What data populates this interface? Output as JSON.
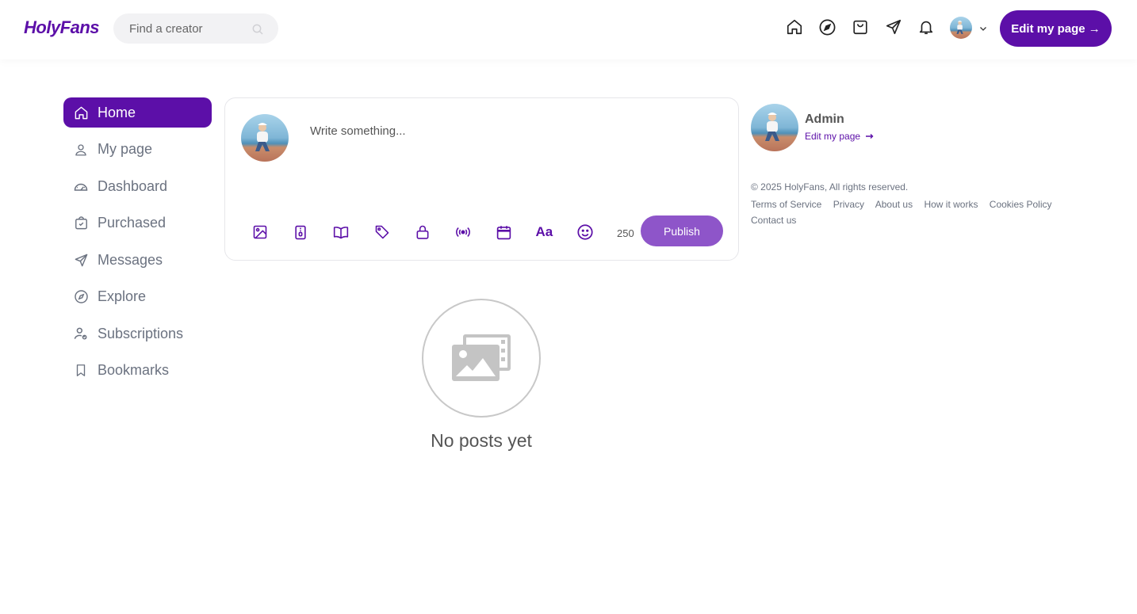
{
  "header": {
    "logo": "HolyFans",
    "search_placeholder": "Find a creator",
    "nav_icons": [
      "home-icon",
      "compass-icon",
      "shopping-bag-icon",
      "send-icon",
      "bell-icon"
    ],
    "edit_button": "Edit my page →"
  },
  "sidebar": {
    "items": [
      {
        "label": "Home",
        "icon": "home-icon",
        "active": true
      },
      {
        "label": "My page",
        "icon": "user-icon"
      },
      {
        "label": "Dashboard",
        "icon": "speedometer-icon"
      },
      {
        "label": "Purchased",
        "icon": "bag-check-icon"
      },
      {
        "label": "Messages",
        "icon": "send-icon"
      },
      {
        "label": "Explore",
        "icon": "compass-icon"
      },
      {
        "label": "Subscriptions",
        "icon": "user-check-icon"
      },
      {
        "label": "Bookmarks",
        "icon": "bookmark-icon"
      }
    ]
  },
  "composer": {
    "placeholder": "Write something...",
    "tools": [
      "image-icon",
      "file-zip-icon",
      "book-icon",
      "tag-icon",
      "lock-icon",
      "broadcast-icon",
      "calendar-icon",
      "text-format-icon",
      "emoji-icon"
    ],
    "text_tool_label": "Aa",
    "char_counter": "250",
    "publish_label": "Publish"
  },
  "feed": {
    "empty_text": "No posts yet"
  },
  "profile": {
    "name": "Admin",
    "edit_link": "Edit my page"
  },
  "footer": {
    "copyright": "© 2025 HolyFans, All rights reserved.",
    "links": [
      "Terms of Service",
      "Privacy",
      "About us",
      "How it works",
      "Cookies Policy",
      "Contact us"
    ]
  },
  "colors": {
    "brand": "#5c0fa8",
    "publish": "#8e55c9",
    "muted_text": "#6b7280"
  }
}
